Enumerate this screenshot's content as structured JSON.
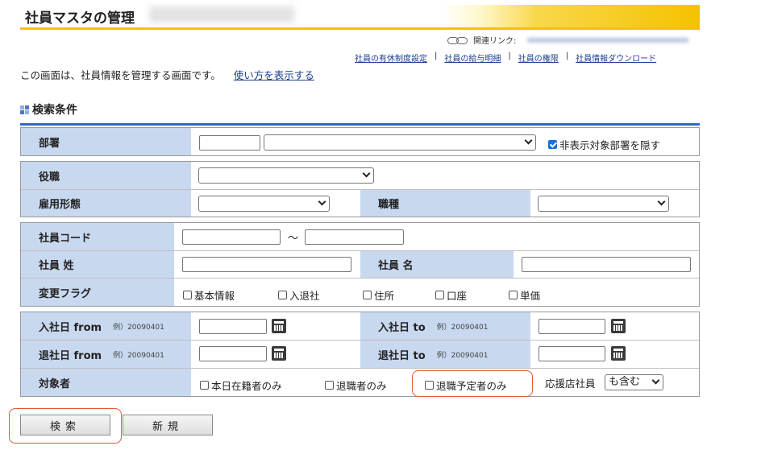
{
  "page": {
    "title": "社員マスタの管理",
    "related_label": "関連リンク:",
    "links": [
      "社員の有休制度設定",
      "社員の給与明細",
      "社員の権限",
      "社員情報ダウンロード"
    ],
    "link_sep": "|",
    "intro": "この画面は、社員情報を管理する画面です。",
    "howto_link": "使い方を表示する",
    "section_title": "検索条件"
  },
  "form": {
    "dept_label": "部署",
    "hide_dept_label": "非表示対象部署を隠す",
    "position_label": "役職",
    "employment_label": "雇用形態",
    "jobtype_label": "職種",
    "code_label": "社員コード",
    "tilde": "〜",
    "lastname_label": "社員 姓",
    "firstname_label": "社員 名",
    "flag_label": "変更フラグ",
    "flags": [
      "基本情報",
      "入退社",
      "住所",
      "口座",
      "単価"
    ],
    "hire_from_label": "入社日 from",
    "hire_to_label": "入社日 to",
    "leave_from_label": "退社日 from",
    "leave_to_label": "退社日 to",
    "date_example": "例）20090401",
    "target_label": "対象者",
    "target_opts": [
      "本日在籍者のみ",
      "退職者のみ",
      "退職予定者のみ"
    ],
    "support_label": "応援店社員",
    "support_value": "も含む"
  },
  "buttons": {
    "search": "検索",
    "new": "新規"
  },
  "colors": {
    "accent": "#f5c200",
    "label_bg": "#c8d8ef",
    "rule": "#3366cc",
    "highlight": "#e05a3a"
  }
}
